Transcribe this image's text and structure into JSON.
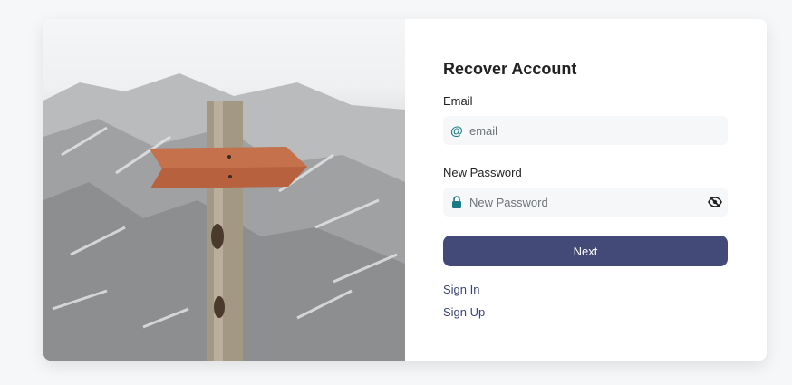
{
  "form": {
    "title": "Recover Account",
    "email_label": "Email",
    "email_placeholder": "email",
    "email_value": "",
    "email_icon": "at-icon",
    "password_label": "New Password",
    "password_placeholder": "New Password",
    "password_value": "",
    "password_icon": "lock-icon",
    "password_toggle_icon": "eye-off-icon",
    "submit_label": "Next"
  },
  "links": {
    "sign_in": "Sign In",
    "sign_up": "Sign Up"
  },
  "colors": {
    "accent": "#434a78",
    "icon": "#1b7a84",
    "field_bg": "#f6f7f9"
  }
}
